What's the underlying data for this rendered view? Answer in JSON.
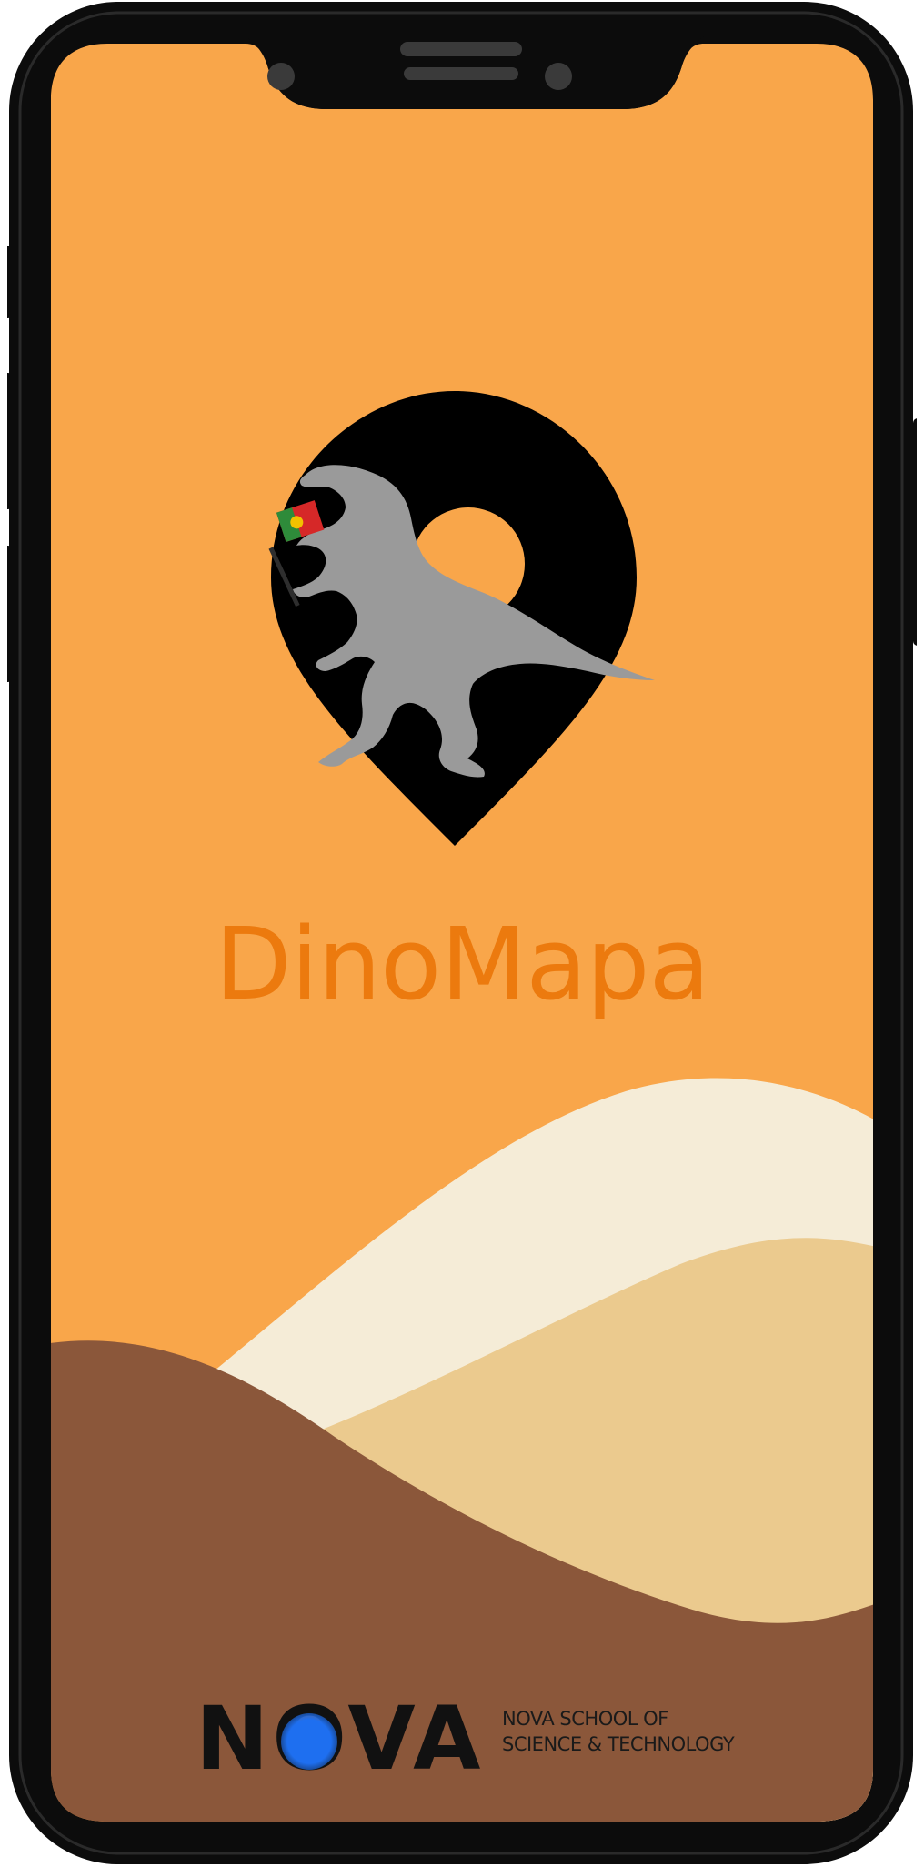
{
  "app": {
    "name": "DinoMapa"
  },
  "logo": {
    "icon": "location-pin-with-t-rex-and-portugal-flag",
    "pin_color": "#000000",
    "dino_color": "#9a9a9a",
    "flag_colors": [
      "#d62828",
      "#2e8b3a",
      "#f2c200"
    ]
  },
  "sponsor": {
    "wordmark": "NOVA",
    "tagline_line1": "NOVA SCHOOL OF",
    "tagline_line2": "SCIENCE & TECHNOLOGY",
    "dot_color": "#1e6ff0"
  },
  "colors": {
    "background": "#f9a64a",
    "title": "#ec7a0e",
    "dune_light": "#f5ecd7",
    "dune_mid": "#ebca8e",
    "dune_dark": "#8b573a",
    "frame": "#0c0c0c"
  }
}
